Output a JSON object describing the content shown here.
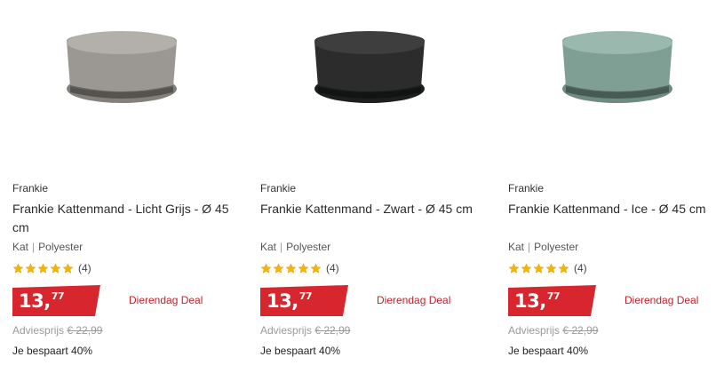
{
  "products": [
    {
      "brand": "Frankie",
      "title": "Frankie Kattenmand - Licht Grijs - Ø 45 cm",
      "meta_a": "Kat",
      "meta_sep": "|",
      "meta_b": "Polyester",
      "rating": 5,
      "review_count": "(4)",
      "price_whole": "13,",
      "price_cents": "77",
      "deal": "Dierendag Deal",
      "advies_label": "Adviesprijs",
      "advies_price": "€ 22,99",
      "saving": "Je bespaart 40%",
      "color_outer": "#9b9893",
      "color_inner": "#b3b0aa",
      "color_base": "#83807b"
    },
    {
      "brand": "Frankie",
      "title": "Frankie Kattenmand - Zwart - Ø 45 cm",
      "meta_a": "Kat",
      "meta_sep": "|",
      "meta_b": "Polyester",
      "rating": 5,
      "review_count": "(4)",
      "price_whole": "13,",
      "price_cents": "77",
      "deal": "Dierendag Deal",
      "advies_label": "Adviesprijs",
      "advies_price": "€ 22,99",
      "saving": "Je bespaart 40%",
      "color_outer": "#2c2c2c",
      "color_inner": "#3e3e3e",
      "color_base": "#1d1f1f"
    },
    {
      "brand": "Frankie",
      "title": "Frankie Kattenmand - Ice - Ø 45 cm",
      "meta_a": "Kat",
      "meta_sep": "|",
      "meta_b": "Polyester",
      "rating": 5,
      "review_count": "(4)",
      "price_whole": "13,",
      "price_cents": "77",
      "deal": "Dierendag Deal",
      "advies_label": "Adviesprijs",
      "advies_price": "€ 22,99",
      "saving": "Je bespaart 40%",
      "color_outer": "#7f9f95",
      "color_inner": "#9ab8ad",
      "color_base": "#6f8a81"
    }
  ],
  "colors": {
    "price_badge": "#d7262e",
    "star": "#f5b400",
    "deal_text": "#c8202a"
  }
}
